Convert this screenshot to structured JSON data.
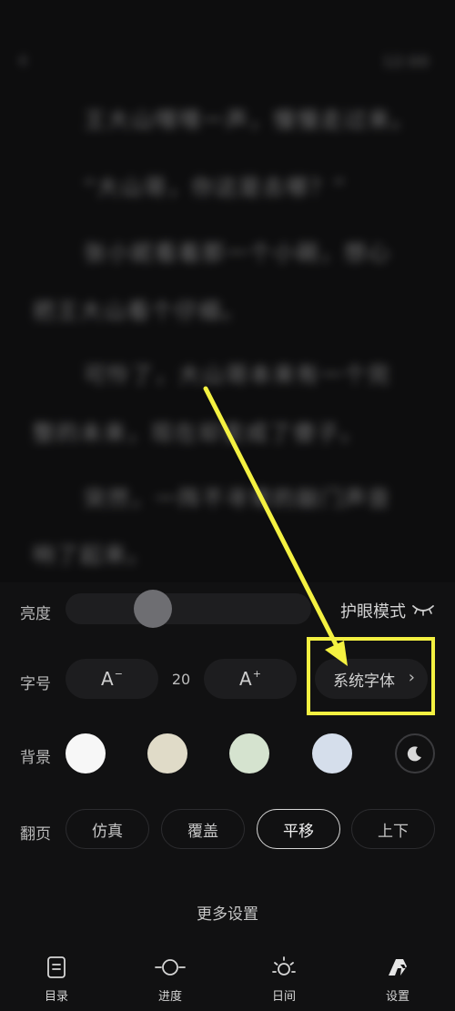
{
  "reader": {
    "back_icon": "chevron-left-icon",
    "clock": "12:00",
    "lines": [
      "王大山嘿嘿一声，慢慢走过来。",
      "“大山哥，你这是去哪？”",
      "张小妮看着那一个小碗，想心",
      "把王大山看个仔细。",
      "可怜了，大山哥本来有一个完",
      "整的未来，现在却变成了傻子。",
      "突然，一阵不寻常的敲门声音",
      "响了起来。"
    ]
  },
  "settings": {
    "brightness": {
      "label": "亮度",
      "level": 0.33,
      "eye_mode_label": "护眼模式",
      "eye_icon": "closed-eye-icon"
    },
    "font": {
      "label": "字号",
      "decrease_label": "A",
      "decrease_sign": "−",
      "value": "20",
      "increase_label": "A",
      "increase_sign": "+",
      "family_label": "系统字体",
      "family_chevron": "›"
    },
    "background": {
      "label": "背景",
      "swatches": [
        "#f7f7f7",
        "#e0dbc8",
        "#d5e3cf",
        "#d5deeb"
      ],
      "night_icon": "moon-icon"
    },
    "page_turn": {
      "label": "翻页",
      "options": [
        "仿真",
        "覆盖",
        "平移",
        "上下"
      ],
      "selected": "平移"
    },
    "more_label": "更多设置"
  },
  "nav": {
    "items": [
      {
        "label": "目录",
        "icon": "catalog-icon"
      },
      {
        "label": "进度",
        "icon": "progress-icon"
      },
      {
        "label": "日间",
        "icon": "sun-icon"
      },
      {
        "label": "设置",
        "icon": "settings-icon"
      }
    ]
  },
  "colors": {
    "annotation": "#f4f141",
    "background": "#111112",
    "pill": "#1d1d1f"
  }
}
